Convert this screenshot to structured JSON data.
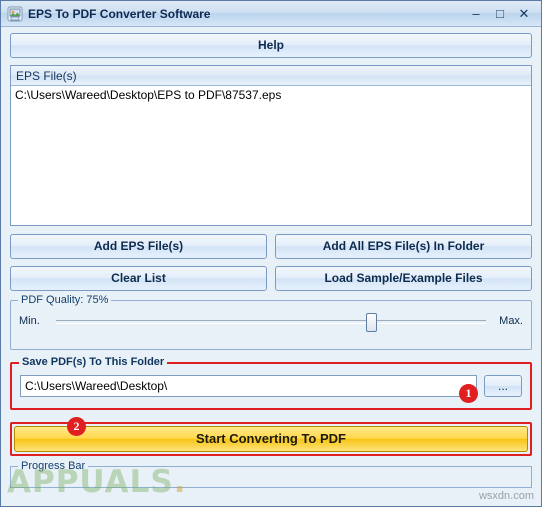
{
  "window": {
    "title": "EPS To PDF Converter Software",
    "icon": "app-icon",
    "buttons": {
      "minimize": "–",
      "maximize": "□",
      "close": "✕"
    }
  },
  "toolbar": {
    "help_label": "Help"
  },
  "file_list": {
    "header": "EPS File(s)",
    "rows": [
      "C:\\Users\\Wareed\\Desktop\\EPS to PDF\\87537.eps"
    ]
  },
  "actions": {
    "add_eps_files": "Add EPS File(s)",
    "add_all_in_folder": "Add All EPS File(s) In Folder",
    "clear_list": "Clear List",
    "load_samples": "Load Sample/Example Files"
  },
  "quality": {
    "title": "PDF Quality: 75%",
    "min_label": "Min.",
    "max_label": "Max.",
    "value": 75
  },
  "save_folder": {
    "title": "Save PDF(s) To This Folder",
    "path": "C:\\Users\\Wareed\\Desktop\\",
    "browse_label": "...",
    "callout": "1"
  },
  "convert": {
    "label": "Start Converting To PDF",
    "callout": "2"
  },
  "progress": {
    "title": "Progress Bar"
  },
  "watermarks": {
    "brand": "APPUALS",
    "brand_dot": ".",
    "corner": "wsxdn.com"
  },
  "colors": {
    "accent_red": "#e02020",
    "convert_yellow": "#ffd84a",
    "window_bg": "#e8f0f8"
  }
}
